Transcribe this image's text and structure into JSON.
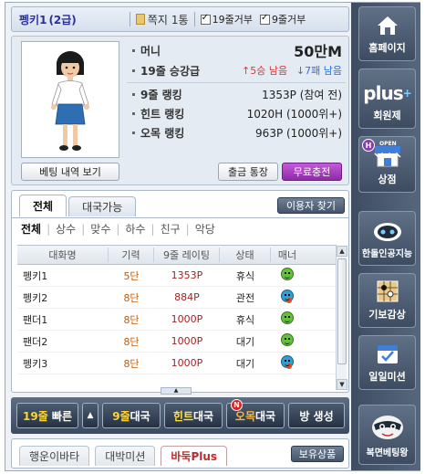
{
  "top": {
    "nickname": "펭키1",
    "grade": "(2급)",
    "memo_label": "쪽지",
    "memo_count": "1통",
    "refuse19_label": "19줄거부",
    "refuse9_label": "9줄거부"
  },
  "profile": {
    "money_label": "머니",
    "money_value": "50만M",
    "promo_label": "19줄 승강급",
    "promo_up": "↑5승 남음",
    "promo_down": "↓7패 남음",
    "ranks": [
      {
        "label": "9줄 랭킹",
        "value": "1353P (참여 전)"
      },
      {
        "label": "힌트 랭킹",
        "value": "1020H (1000위+)"
      },
      {
        "label": "오목 랭킹",
        "value": "963P (1000위+)"
      }
    ],
    "history_button": "베팅 내역 보기",
    "withdraw_button": "출금 통장",
    "free_charge_button": "무료충전"
  },
  "list": {
    "tabs": [
      "전체",
      "대국가능"
    ],
    "find_user_button": "이용자 찾기",
    "filters": [
      "전체",
      "상수",
      "맞수",
      "하수",
      "친구",
      "악당"
    ],
    "columns": [
      "대화명",
      "기력",
      "9줄 레이팅",
      "상태",
      "매너"
    ],
    "rows": [
      {
        "name": "펭키1",
        "dan": "5단",
        "rating": "1353P",
        "status": "휴식",
        "manner": "good"
      },
      {
        "name": "펭키2",
        "dan": "8단",
        "rating": "884P",
        "status": "관전",
        "manner": "angry"
      },
      {
        "name": "팬더1",
        "dan": "8단",
        "rating": "1000P",
        "status": "휴식",
        "manner": "good"
      },
      {
        "name": "팬더2",
        "dan": "8단",
        "rating": "1000P",
        "status": "대기",
        "manner": "good"
      },
      {
        "name": "펭키3",
        "dan": "8단",
        "rating": "1000P",
        "status": "대기",
        "manner": "angry"
      }
    ]
  },
  "actions": {
    "quick19_prefix": "19줄",
    "quick19_suffix": "빠른",
    "game9_prefix": "9줄",
    "game9_suffix": "대국",
    "hint_prefix": "힌트",
    "hint_suffix": "대국",
    "omok_prefix": "오목",
    "omok_suffix": "대국",
    "new_badge": "N",
    "create_room": "방 생성"
  },
  "bottom": {
    "tabs": [
      "행운이바타",
      "대박미션",
      "바둑Plus"
    ],
    "owned_items_button": "보유상품"
  },
  "sidebar": {
    "items": [
      {
        "label": "홈페이지",
        "icon": "home-icon"
      },
      {
        "label": "회원제",
        "icon": "plus-logo"
      },
      {
        "label": "상점",
        "icon": "shop-icon"
      },
      {
        "label": "한돌인공지능",
        "icon": "robot-icon"
      },
      {
        "label": "기보감상",
        "icon": "board-icon"
      },
      {
        "label": "일일미션",
        "icon": "calendar-check-icon"
      },
      {
        "label": "복면베팅왕",
        "icon": "mask-icon"
      }
    ],
    "plus_text": "plus",
    "plus_sup": "+",
    "shop_h": "H",
    "shop_open": "OPEN"
  }
}
